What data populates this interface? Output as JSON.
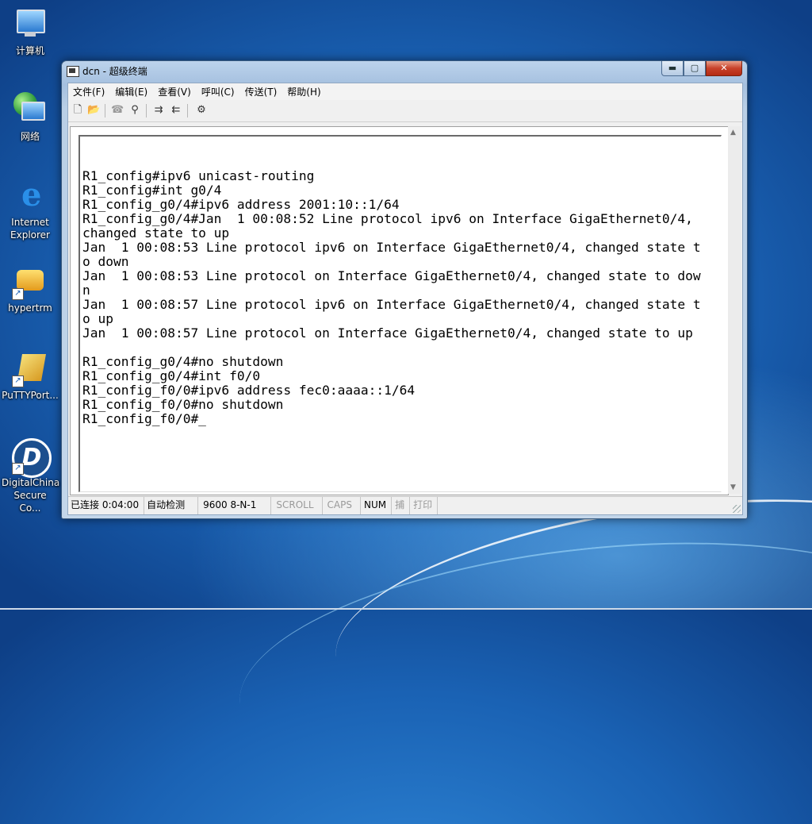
{
  "desktop": {
    "icons": [
      {
        "label": "计算机"
      },
      {
        "label": "网络"
      },
      {
        "label": "Internet Explorer"
      },
      {
        "label": "hypertrm"
      },
      {
        "label": "PuTTYPort..."
      },
      {
        "label": "DigitalChina Secure Co..."
      }
    ]
  },
  "window": {
    "title": "dcn - 超级终端",
    "buttons": {
      "minimize": "▬",
      "maximize": "▢",
      "close": "✕"
    },
    "menu": [
      "文件(F)",
      "编辑(E)",
      "查看(V)",
      "呼叫(C)",
      "传送(T)",
      "帮助(H)"
    ],
    "toolbar": {
      "new": "🗋",
      "open": "📂",
      "disconnect": "☎",
      "call": "⚲",
      "send": "⇉",
      "receive": "⇇",
      "properties": "⚙"
    },
    "terminal_lines": [
      "",
      "R1_config#ipv6 unicast-routing",
      "R1_config#int g0/4",
      "R1_config_g0/4#ipv6 address 2001:10::1/64",
      "R1_config_g0/4#Jan  1 00:08:52 Line protocol ipv6 on Interface GigaEthernet0/4,",
      "changed state to up",
      "Jan  1 00:08:53 Line protocol ipv6 on Interface GigaEthernet0/4, changed state t",
      "o down",
      "Jan  1 00:08:53 Line protocol on Interface GigaEthernet0/4, changed state to dow",
      "n",
      "Jan  1 00:08:57 Line protocol ipv6 on Interface GigaEthernet0/4, changed state t",
      "o up",
      "Jan  1 00:08:57 Line protocol on Interface GigaEthernet0/4, changed state to up",
      "",
      "R1_config_g0/4#no shutdown",
      "R1_config_g0/4#int f0/0",
      "R1_config_f0/0#ipv6 address fec0:aaaa::1/64",
      "R1_config_f0/0#no shutdown",
      "R1_config_f0/0#_"
    ],
    "status": {
      "connected": "已连接 0:04:00",
      "detect": "自动检测",
      "port": "9600 8-N-1",
      "scroll": "SCROLL",
      "caps": "CAPS",
      "num": "NUM",
      "capture": "捕",
      "print": "打印"
    }
  }
}
